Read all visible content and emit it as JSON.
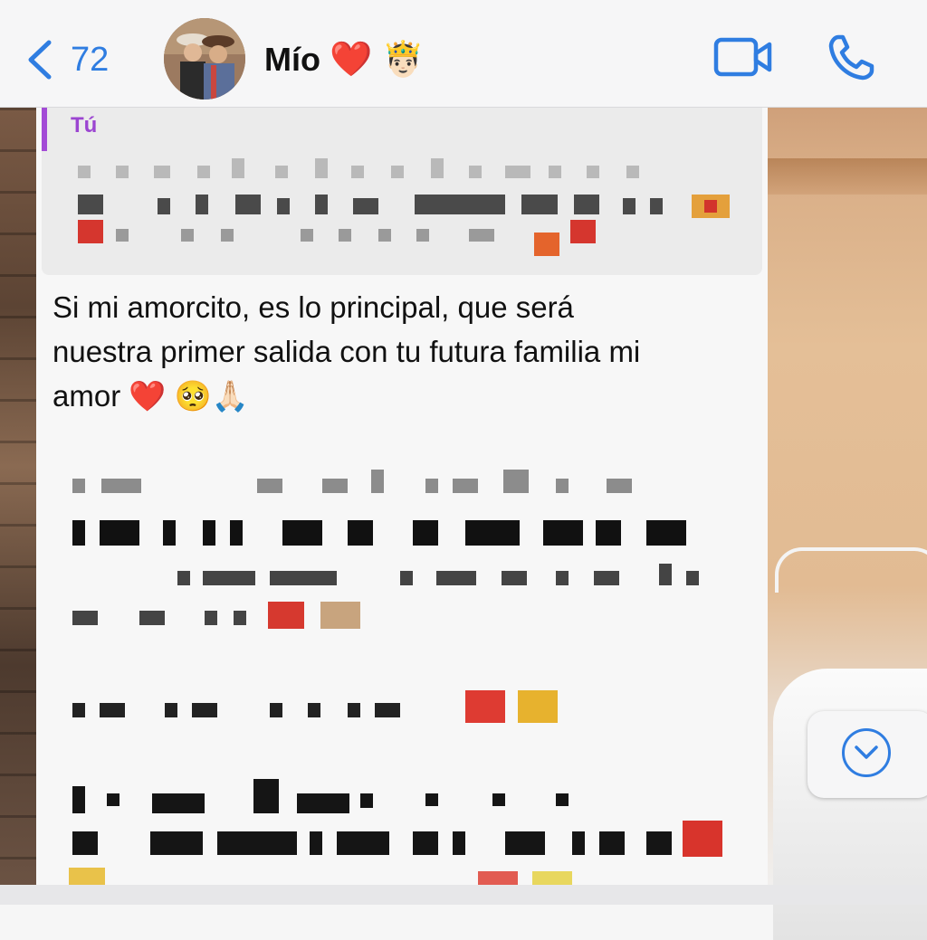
{
  "header": {
    "back_count": "72",
    "contact_name": "Mío",
    "contact_emoji": "❤️ 🤴🏻",
    "icons": {
      "back": "chevron-left-icon",
      "video": "video-camera-icon",
      "call": "phone-icon"
    },
    "accent": "#2f7de1"
  },
  "quoted": {
    "sender": "Tú",
    "sender_color": "#9b45d1"
  },
  "message": {
    "line1": "Si mi amorcito, es lo principal, que será",
    "line2": "nuestra primer salida con tu futura familia mi",
    "line3": "amor ❤️ 🥺🙏🏻"
  },
  "scroll_button": {
    "icon": "chevron-down-circle-icon"
  }
}
